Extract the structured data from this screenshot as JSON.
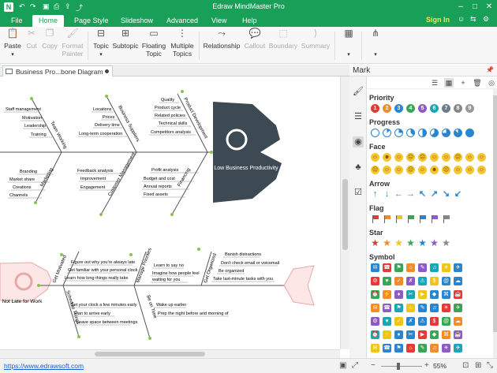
{
  "app": {
    "title": "Edraw MindMaster Pro",
    "logo": "N"
  },
  "quick_access": [
    "undo-icon",
    "redo-icon",
    "save-icon",
    "print-icon",
    "export-icon",
    "share-icon"
  ],
  "menu": {
    "tabs": [
      "File",
      "Home",
      "Page Style",
      "Slideshow",
      "Advanced",
      "View",
      "Help"
    ],
    "active": "Home",
    "sign_in": "Sign In"
  },
  "ribbon": {
    "buttons": [
      {
        "label": "Paste",
        "icon": "clipboard-icon",
        "disabled": false
      },
      {
        "label": "Cut",
        "icon": "scissors-icon",
        "disabled": true
      },
      {
        "label": "Copy",
        "icon": "copy-icon",
        "disabled": true
      },
      {
        "label": "Format\nPainter",
        "icon": "brush-icon",
        "disabled": true
      },
      {
        "label": "Topic",
        "icon": "topic-icon",
        "disabled": false
      },
      {
        "label": "Subtopic",
        "icon": "subtopic-icon",
        "disabled": false
      },
      {
        "label": "Floating\nTopic",
        "icon": "floating-topic-icon",
        "disabled": false
      },
      {
        "label": "Multiple\nTopics",
        "icon": "multiple-topics-icon",
        "disabled": false
      },
      {
        "label": "Relationship",
        "icon": "relationship-icon",
        "disabled": false
      },
      {
        "label": "Callout",
        "icon": "callout-icon",
        "disabled": true
      },
      {
        "label": "Boundary",
        "icon": "boundary-icon",
        "disabled": true
      },
      {
        "label": "Summary",
        "icon": "summary-icon",
        "disabled": true
      }
    ]
  },
  "document": {
    "tab": "Business Pro...bone Diagram"
  },
  "diagram1": {
    "head": "Low Business Productivity",
    "branches": [
      "Team Working",
      "Business Suppliers",
      "Product Development",
      "Marketing",
      "Customer Management",
      "Financing"
    ],
    "team": [
      "Staff management",
      "Motivation",
      "Leadership",
      "Training"
    ],
    "suppliers": [
      "Locations",
      "Prices",
      "Delivery time",
      "Long-term cooperation"
    ],
    "product": [
      "Quality",
      "Product cycle",
      "Related policies",
      "Technical skills",
      "Competitors analysis"
    ],
    "marketing": [
      "Branding",
      "Market share",
      "Creations",
      "Channels"
    ],
    "customer": [
      "Feedback analysis",
      "Improvement",
      "Engagement"
    ],
    "financing": [
      "Profit analysis",
      "Budget and cost",
      "Annual reports",
      "Fixed assets"
    ]
  },
  "diagram2": {
    "head": "Not Late for Work",
    "branches": [
      "Get Motivated",
      "Manage Priorities",
      "Get Organized",
      "Schedule Things",
      "Be on Time"
    ],
    "motivated": [
      "Figure out why you're always late",
      "Get familiar with your personal clock",
      "Learn how long things really take"
    ],
    "priorities": [
      "Learn to say no",
      "Imagine how people feel",
      "waiting for you"
    ],
    "organized": [
      "Banish distractions",
      "Don't check email or voicemail",
      "Be organized",
      "Take last-minute tasks with you"
    ],
    "schedule": [
      "Set your clock a few minutes early",
      "Plan to arrive early",
      "Leave space between meetings"
    ],
    "ontime": [
      "Wake up earlier",
      "Prep the night before and morning of"
    ]
  },
  "panel": {
    "title": "Mark",
    "sections": {
      "priority": "Priority",
      "progress": "Progress",
      "face": "Face",
      "arrow": "Arrow",
      "flag": "Flag",
      "star": "Star",
      "symbol": "Symbol"
    },
    "priority": [
      "1",
      "2",
      "3",
      "4",
      "5",
      "6",
      "7",
      "8",
      "9"
    ],
    "priority_colors": [
      "#e53935",
      "#f28c28",
      "#2a85d0",
      "#3aa655",
      "#8e5bc4",
      "#1aa6b7",
      "#6d7b8d",
      "#888888",
      "#999999"
    ],
    "faces": [
      "☺",
      "☻",
      "☺",
      "☹",
      "☹",
      "☺",
      "☺",
      "☹",
      "☺",
      "☺",
      "☹",
      "☺",
      "☺",
      "☹",
      "☺",
      "☻",
      "☹",
      "☺",
      "☺",
      "☺"
    ],
    "arrows": [
      "↑",
      "↓",
      "←",
      "→",
      "↖",
      "↗",
      "↘",
      "↙"
    ],
    "flag_colors": [
      "#e53935",
      "#f28c28",
      "#f0c419",
      "#3aa655",
      "#2a85d0",
      "#8e5bc4",
      "#888888"
    ],
    "star_colors": [
      "#e53935",
      "#f28c28",
      "#f0c419",
      "#3aa655",
      "#2a85d0",
      "#8e5bc4",
      "#888888"
    ],
    "symbol_colors": [
      "#2a85d0",
      "#e53935",
      "#3aa655",
      "#f28c28",
      "#8e5bc4",
      "#1aa6b7",
      "#f0c419",
      "#2a85d0"
    ]
  },
  "status": {
    "link": "https://www.edrawsoft.com",
    "zoom": "55%"
  }
}
